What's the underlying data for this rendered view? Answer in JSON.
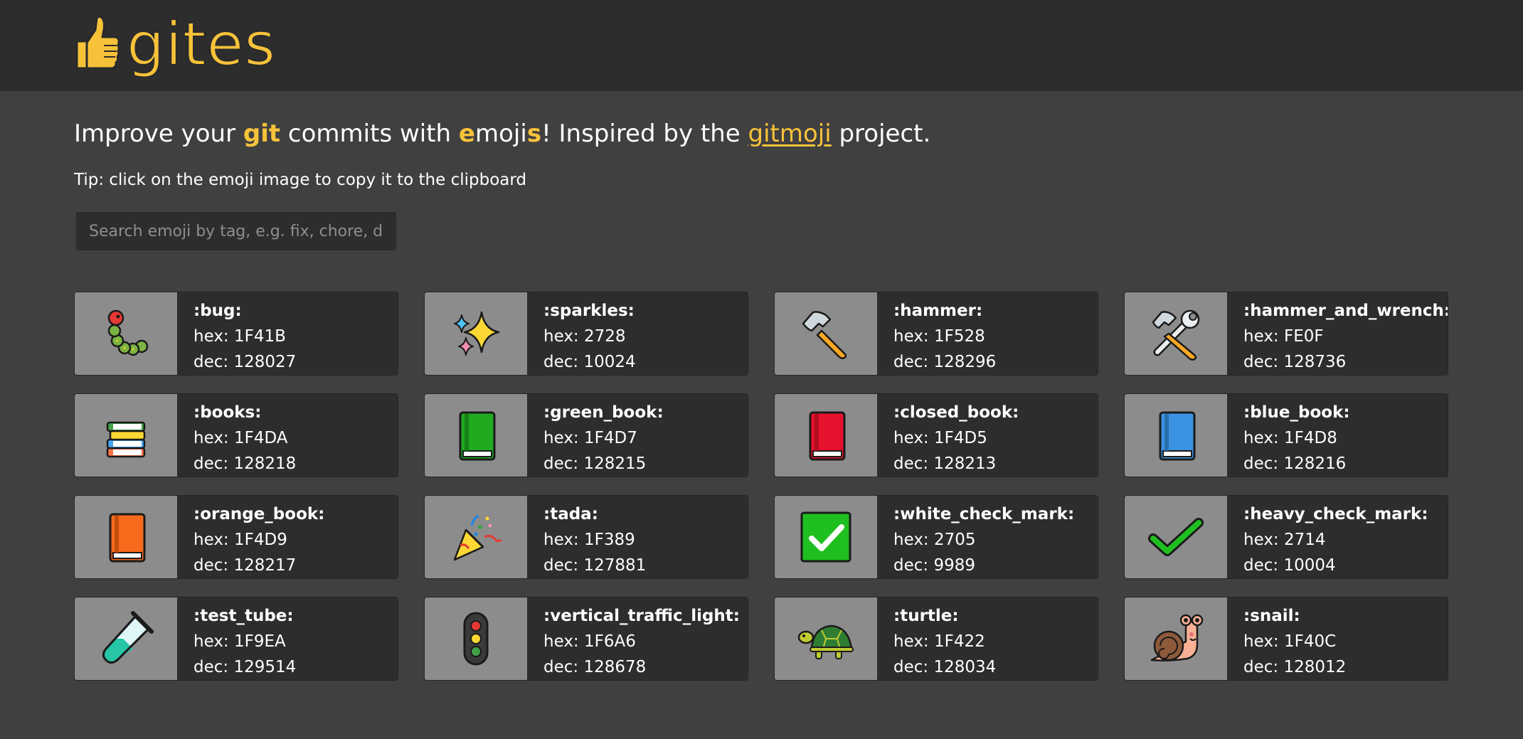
{
  "app": {
    "logo_text": "gites",
    "accent": "#f7c23a"
  },
  "tagline": {
    "part1": "Improve your ",
    "git": "git",
    "part2": " commits with ",
    "e": "e",
    "moji": "moji",
    "s": "s",
    "part3": "! Inspired by the ",
    "link": "gitmoji",
    "part4": " project."
  },
  "tip": "Tip: click on the emoji image to copy it to the clipboard",
  "search": {
    "placeholder": "Search emoji by tag, e.g. fix, chore, doc",
    "value": ""
  },
  "emojis": [
    {
      "code": ":bug:",
      "hex": "hex: 1F41B",
      "dec": "dec: 128027",
      "icon": "bug-icon"
    },
    {
      "code": ":sparkles:",
      "hex": "hex: 2728",
      "dec": "dec: 10024",
      "icon": "sparkles-icon"
    },
    {
      "code": ":hammer:",
      "hex": "hex: 1F528",
      "dec": "dec: 128296",
      "icon": "hammer-icon"
    },
    {
      "code": ":hammer_and_wrench:",
      "hex": "hex: FE0F",
      "dec": "dec: 128736",
      "icon": "hammer-and-wrench-icon"
    },
    {
      "code": ":books:",
      "hex": "hex: 1F4DA",
      "dec": "dec: 128218",
      "icon": "books-icon"
    },
    {
      "code": ":green_book:",
      "hex": "hex: 1F4D7",
      "dec": "dec: 128215",
      "icon": "green-book-icon"
    },
    {
      "code": ":closed_book:",
      "hex": "hex: 1F4D5",
      "dec": "dec: 128213",
      "icon": "closed-book-icon"
    },
    {
      "code": ":blue_book:",
      "hex": "hex: 1F4D8",
      "dec": "dec: 128216",
      "icon": "blue-book-icon"
    },
    {
      "code": ":orange_book:",
      "hex": "hex: 1F4D9",
      "dec": "dec: 128217",
      "icon": "orange-book-icon"
    },
    {
      "code": ":tada:",
      "hex": "hex: 1F389",
      "dec": "dec: 127881",
      "icon": "tada-icon"
    },
    {
      "code": ":white_check_mark:",
      "hex": "hex: 2705",
      "dec": "dec: 9989",
      "icon": "white-check-mark-icon"
    },
    {
      "code": ":heavy_check_mark:",
      "hex": "hex: 2714",
      "dec": "dec: 10004",
      "icon": "heavy-check-mark-icon"
    },
    {
      "code": ":test_tube:",
      "hex": "hex: 1F9EA",
      "dec": "dec: 129514",
      "icon": "test-tube-icon"
    },
    {
      "code": ":vertical_traffic_light:",
      "hex": "hex: 1F6A6",
      "dec": "dec: 128678",
      "icon": "traffic-light-icon"
    },
    {
      "code": ":turtle:",
      "hex": "hex: 1F422",
      "dec": "dec: 128034",
      "icon": "turtle-icon"
    },
    {
      "code": ":snail:",
      "hex": "hex: 1F40C",
      "dec": "dec: 128012",
      "icon": "snail-icon"
    }
  ]
}
